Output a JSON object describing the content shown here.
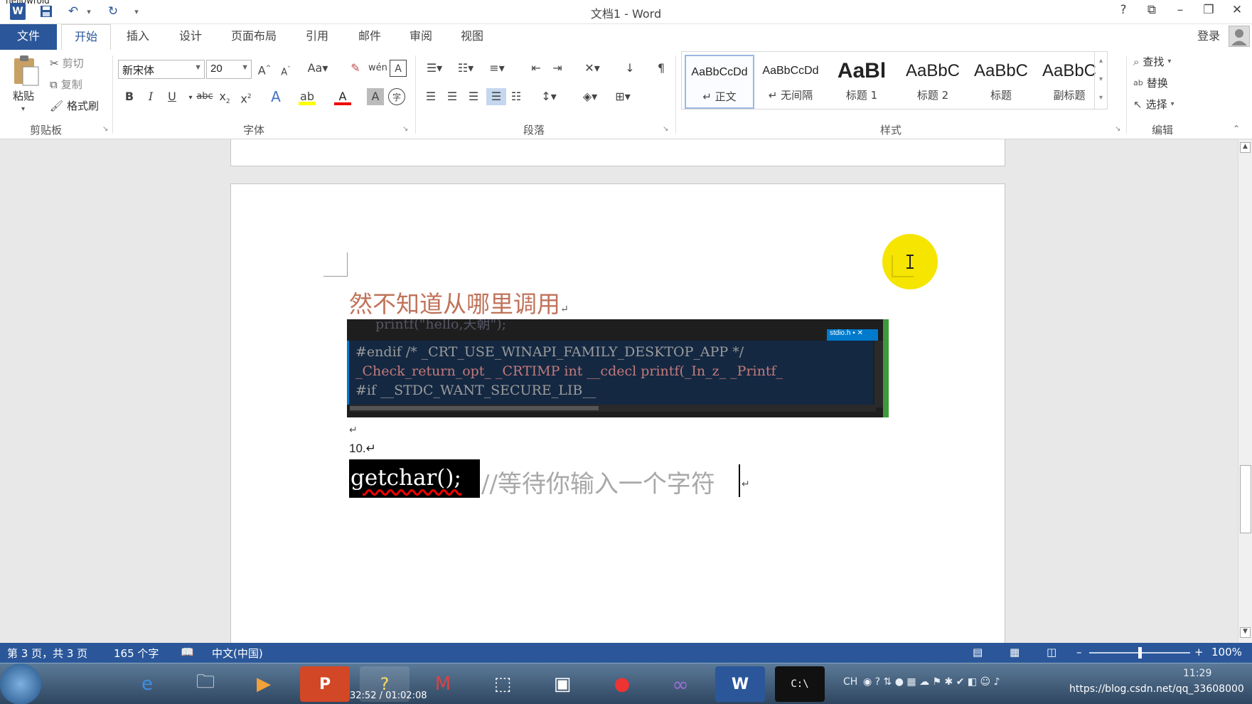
{
  "window": {
    "doc_title": "hellowrold",
    "title": "文档1 - Word",
    "help": "?",
    "ribbon_display": "⧉",
    "minimize": "–",
    "restore": "❐",
    "close": "✕",
    "qat": {
      "word": "W",
      "save": "💾",
      "undo": "↶",
      "redo": "↻",
      "customize": "▾"
    }
  },
  "tabs": [
    "文件",
    "开始",
    "插入",
    "设计",
    "页面布局",
    "引用",
    "邮件",
    "审阅",
    "视图"
  ],
  "account": {
    "login": "登录"
  },
  "clipboard": {
    "paste": "粘贴",
    "cut": "剪切",
    "copy": "复制",
    "format_painter": "格式刷",
    "group": "剪贴板"
  },
  "font": {
    "name": "新宋体",
    "size": "20",
    "group": "字体"
  },
  "paragraph": {
    "group": "段落"
  },
  "styles": {
    "group": "样式",
    "items": [
      {
        "sample": "AaBbCcDd",
        "name": "↵ 正文"
      },
      {
        "sample": "AaBbCcDd",
        "name": "↵ 无间隔"
      },
      {
        "sample": "AaBl",
        "name": "标题 1"
      },
      {
        "sample": "AaBbC",
        "name": "标题 2"
      },
      {
        "sample": "AaBbC",
        "name": "标题"
      },
      {
        "sample": "AaBbC",
        "name": "副标题"
      }
    ]
  },
  "editing": {
    "find": "查找",
    "replace": "替换",
    "select": "选择",
    "group": "编辑"
  },
  "document": {
    "heading_text": "然不知道从哪里调用",
    "para_mark": "↵",
    "item_number": "10.↵",
    "code_highlight": "getchar();",
    "comment_text": "//等待你输入一个字符",
    "code_lines": [
      {
        "text": "#endif  /* _CRT_USE_WINAPI_FAMILY_DESKTOP_APP */"
      },
      {
        "text": "_Check_return_opt_ _CRTIMP int __cdecl printf(_In_z_ _Printf_"
      },
      {
        "text": "#if __STDC_WANT_SECURE_LIB__"
      }
    ],
    "code_top_partial": "printf(\"hello,天朝\");",
    "code_tab": "stdio.h"
  },
  "status": {
    "page": "第 3 页，共 3 页",
    "words": "165 个字",
    "language": "中文(中国)",
    "zoom": "100%",
    "zoom_level": 1.0
  },
  "taskbar": {
    "video_time": "32:52 / 01:02:08",
    "tray_lang": "CH",
    "clock": "11:29",
    "url": "https://blog.csdn.net/qq_33608000"
  },
  "colors": {
    "accent": "#2b579a",
    "heading": "#c0735a",
    "highlight_cursor": "#f5e500"
  }
}
